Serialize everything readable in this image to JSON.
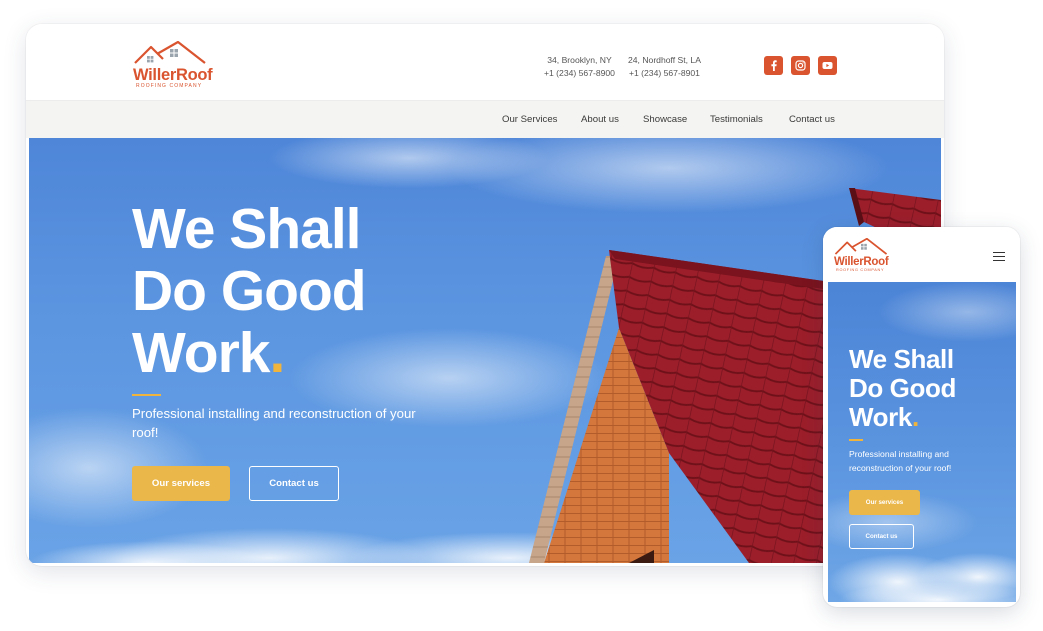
{
  "brand": {
    "name": "WillerRoof",
    "tagline": "ROOFING COMPANY",
    "accent_color": "#d9542f",
    "highlight_color": "#f0b43c",
    "button_color": "#eab74b"
  },
  "header": {
    "locations": [
      {
        "address": "34, Brooklyn, NY",
        "phone": "+1 (234) 567-8900"
      },
      {
        "address": "24, Nordhoff St, LA",
        "phone": "+1 (234) 567-8901"
      }
    ],
    "social": [
      {
        "icon": "facebook-icon"
      },
      {
        "icon": "instagram-icon"
      },
      {
        "icon": "youtube-icon"
      }
    ]
  },
  "nav": {
    "items": [
      {
        "label": "Our Services"
      },
      {
        "label": "About us"
      },
      {
        "label": "Showcase"
      },
      {
        "label": "Testimonials"
      },
      {
        "label": "Contact us"
      }
    ]
  },
  "hero": {
    "title_lines": [
      "We Shall",
      "Do Good",
      "Work"
    ],
    "title_dot": ".",
    "subtitle": "Professional installing and reconstruction of your roof!",
    "primary_button": "Our services",
    "secondary_button": "Contact us"
  },
  "mobile": {
    "menu_icon": "hamburger-menu-icon"
  }
}
